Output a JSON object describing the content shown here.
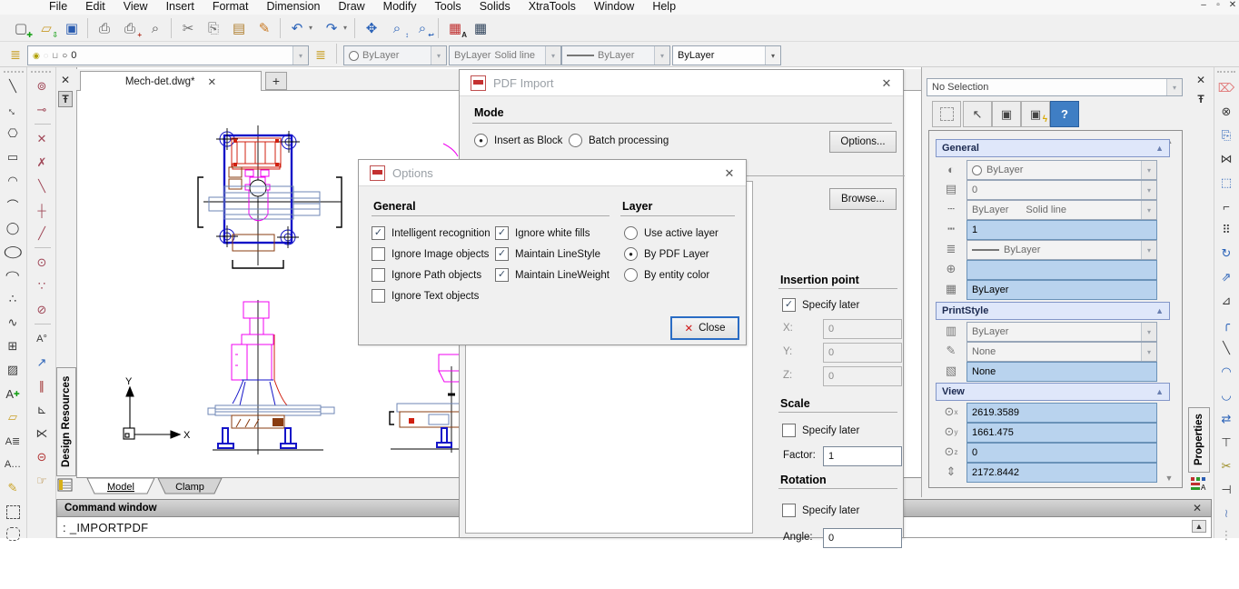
{
  "glyphs": {
    "close": "✕",
    "pin": "Ŧ",
    "caret": "▾",
    "up": "▲",
    "down": "▼",
    "check": "✓",
    "plus": "+",
    "collapse": "▲",
    "dot": "●",
    "minimize": "–",
    "restore": "▫"
  },
  "colors": {
    "field_blue": "#b9d3ee",
    "section_header_bg": "#dfe7fa",
    "help_blue": "#3f7ec4",
    "close_focus_border": "#2a6cc4",
    "accent_blue": "#2a62b8"
  },
  "menu": {
    "items": [
      "File",
      "Edit",
      "View",
      "Insert",
      "Format",
      "Dimension",
      "Draw",
      "Modify",
      "Tools",
      "Solids",
      "XtraTools",
      "Window",
      "Help"
    ]
  },
  "toolbar_main": {
    "icons": [
      {
        "name": "new-file",
        "glyph": "▢",
        "badge": "✚"
      },
      {
        "name": "open-file",
        "glyph": "▱",
        "badge": "⇩"
      },
      {
        "name": "save",
        "glyph": "▣"
      },
      {
        "name": "print",
        "glyph": "⎙"
      },
      {
        "name": "print-copies",
        "glyph": "⎙",
        "badge": "+"
      },
      {
        "name": "print-preview",
        "glyph": "⌕"
      },
      {
        "name": "cut",
        "glyph": "✂"
      },
      {
        "name": "copy",
        "glyph": "⎘"
      },
      {
        "name": "paste",
        "glyph": "▤"
      },
      {
        "name": "draw-pen",
        "glyph": "✎"
      },
      {
        "name": "undo",
        "glyph": "↶"
      },
      {
        "name": "redo",
        "glyph": "↷"
      },
      {
        "name": "pan",
        "glyph": "✥"
      },
      {
        "name": "zoom-realtime",
        "glyph": "⌕",
        "badge": "↕"
      },
      {
        "name": "zoom-previous",
        "glyph": "⌕",
        "badge": "↩"
      },
      {
        "name": "text-style",
        "glyph": "▦",
        "badge": "A"
      },
      {
        "name": "table",
        "glyph": "▦"
      }
    ]
  },
  "toolbar_layer": {
    "layer_manager_glyph": "≣",
    "bulb_glyph": "◉",
    "freeze_glyph": "◌",
    "lock_glyph": "⊔",
    "swatch_glyph": "○",
    "layer_value": "0",
    "layer_props_glyph": "≣",
    "color_value": "ByLayer",
    "linetype_value": "ByLayer",
    "linetype_style": "Solid line",
    "lineweight_value": "ByLayer",
    "plotstyle_value": "ByLayer"
  },
  "doc_tabs": {
    "active": "Mech-det.dwg*",
    "close": "✕",
    "new_tab": "+"
  },
  "left_toolbar_draw": {
    "icons": [
      {
        "name": "line",
        "glyph": "╲"
      },
      {
        "name": "construction-line",
        "glyph": "↔"
      },
      {
        "name": "polygon",
        "glyph": "⎔"
      },
      {
        "name": "rectangle",
        "glyph": "▭"
      },
      {
        "name": "arc-3point",
        "glyph": "◠"
      },
      {
        "name": "arc",
        "glyph": "⌒"
      },
      {
        "name": "circle",
        "glyph": "◯"
      },
      {
        "name": "ellipse",
        "glyph": "◯"
      },
      {
        "name": "ellipse-arc",
        "glyph": "◠"
      },
      {
        "name": "multiple-points",
        "glyph": "∴"
      },
      {
        "name": "spline",
        "glyph": "∿"
      },
      {
        "name": "insert-block",
        "glyph": "⊞"
      },
      {
        "name": "hatch",
        "glyph": "▨"
      },
      {
        "name": "text-new",
        "glyph": "A",
        "badge": "✚"
      },
      {
        "name": "region",
        "glyph": "▱"
      },
      {
        "name": "mtext",
        "glyph": "A≣"
      },
      {
        "name": "single-text",
        "glyph": "A…"
      },
      {
        "name": "sketch",
        "glyph": "✎"
      },
      {
        "name": "select-rect",
        "glyph": ""
      },
      {
        "name": "select-polygon",
        "glyph": ""
      }
    ]
  },
  "left_toolbar_point": {
    "icons": [
      {
        "name": "point-style",
        "glyph": "⊚"
      },
      {
        "name": "point-single",
        "glyph": "⊸"
      },
      {
        "name": "divider-1",
        "glyph": "|"
      },
      {
        "name": "snap-intersection",
        "glyph": "✕"
      },
      {
        "name": "snap-apparent-intersection",
        "glyph": "✗"
      },
      {
        "name": "snap-nearest",
        "glyph": "╲"
      },
      {
        "name": "snap-from",
        "glyph": "┼"
      },
      {
        "name": "snap-mid",
        "glyph": "╱"
      },
      {
        "name": "divider-2",
        "glyph": "|"
      },
      {
        "name": "snap-center",
        "glyph": "⊙"
      },
      {
        "name": "snap-node",
        "glyph": "∵"
      },
      {
        "name": "snap-tangent",
        "glyph": "⊘"
      },
      {
        "name": "divider-3",
        "glyph": "|"
      },
      {
        "name": "text-angle",
        "glyph": "A°"
      },
      {
        "name": "snap-endpoint",
        "glyph": "↗"
      },
      {
        "name": "snap-parallel",
        "glyph": "∥"
      },
      {
        "name": "snap-perpendicular",
        "glyph": "⊾"
      },
      {
        "name": "snap-extension",
        "glyph": "⋉"
      },
      {
        "name": "snap-none",
        "glyph": "⊝"
      },
      {
        "name": "snap-settings",
        "glyph": "☞"
      }
    ]
  },
  "design_resources": {
    "label": "Design Resources"
  },
  "drawing": {
    "ucs_x": "X",
    "ucs_y": "Y"
  },
  "model_tabs": {
    "tabs": [
      "Model",
      "Clamp"
    ]
  },
  "command_window": {
    "title": "Command window",
    "prompt": ": _IMPORTPDF"
  },
  "pdf_import": {
    "title": "PDF Import",
    "mode": {
      "title": "Mode",
      "radio_insert": "Insert as Block",
      "radio_insert_mark": "●",
      "radio_batch": "Batch processing",
      "radio_batch_mark": "",
      "options_button": "Options..."
    },
    "browse_button": "Browse...",
    "insertion": {
      "title": "Insertion point",
      "specify": "Specify later",
      "specify_mark": "✓",
      "x_label": "X:",
      "x": "0",
      "y_label": "Y:",
      "y": "0",
      "z_label": "Z:",
      "z": "0"
    },
    "scale": {
      "title": "Scale",
      "specify": "Specify later",
      "specify_mark": "",
      "factor_label": "Factor:",
      "factor": "1"
    },
    "rotation": {
      "title": "Rotation",
      "specify": "Specify later",
      "specify_mark": "",
      "angle_label": "Angle:",
      "angle": "0"
    }
  },
  "options_dialog": {
    "title": "Options",
    "general_title": "General",
    "general_items": [
      {
        "label": "Intelligent recognition",
        "mark": "✓"
      },
      {
        "label": "Ignore Image objects",
        "mark": ""
      },
      {
        "label": "Ignore Path objects",
        "mark": ""
      },
      {
        "label": "Ignore Text objects",
        "mark": ""
      },
      {
        "label": "Ignore white fills",
        "mark": "✓"
      },
      {
        "label": "Maintain LineStyle",
        "mark": "✓"
      },
      {
        "label": "Maintain LineWeight",
        "mark": "✓"
      }
    ],
    "layer_title": "Layer",
    "layer_items": [
      {
        "label": "Use active layer",
        "mark": ""
      },
      {
        "label": "By PDF Layer",
        "mark": "●"
      },
      {
        "label": "By entity color",
        "mark": ""
      }
    ],
    "close_button": "Close",
    "close_icon": "✕"
  },
  "properties": {
    "selector": "No Selection",
    "buttons": {
      "select_objects": "⬚",
      "cursor": "↖",
      "window_select": "▣",
      "quick_select": "▣",
      "quick_select_badge": "ϟ",
      "help": "?"
    },
    "general": {
      "title": "General",
      "color_icon": "◐",
      "color": "ByLayer",
      "layer_icon": "▤",
      "layer": "0",
      "linetype_icon": "┄",
      "linetype": "ByLayer",
      "linetype_style": "Solid line",
      "ltscale_icon": "┅",
      "ltscale": "1",
      "lineweight_icon": "≣",
      "lineweight": "ByLayer",
      "hyperlink_icon": "⊕",
      "hyperlink": "",
      "transparency_icon": "▦",
      "transparency": "ByLayer"
    },
    "printstyle": {
      "title": "PrintStyle",
      "style_icon": "▥",
      "style": "ByLayer",
      "table_icon": "✎",
      "table": "None",
      "area_icon": "▧",
      "area": "None"
    },
    "view": {
      "title": "View",
      "cx_icon": "⊙",
      "cx_sub": "x",
      "center_x": "2619.3589",
      "cy_icon": "⊙",
      "cy_sub": "y",
      "center_y": "1661.475",
      "cz_icon": "⊙",
      "cz_sub": "z",
      "center_z": "0",
      "h_icon": "⇕",
      "h_sub": "",
      "height": "2172.8442"
    },
    "side_label": "Properties"
  },
  "right_toolbar": {
    "icons": [
      {
        "name": "erase",
        "glyph": "⌦"
      },
      {
        "name": "oops",
        "glyph": "⊗"
      },
      {
        "name": "copy",
        "glyph": "⎘"
      },
      {
        "name": "mirror",
        "glyph": "⋈"
      },
      {
        "name": "copy-object",
        "glyph": "⬚"
      },
      {
        "name": "offset",
        "glyph": "⌐"
      },
      {
        "name": "array",
        "glyph": "⠿"
      },
      {
        "name": "rotate",
        "glyph": "↻"
      },
      {
        "name": "scale",
        "glyph": "⇗"
      },
      {
        "name": "stretch",
        "glyph": "⊿"
      },
      {
        "name": "fillet",
        "glyph": "╭"
      },
      {
        "name": "chamfer",
        "glyph": "╲"
      },
      {
        "name": "blend-curve",
        "glyph": "◠"
      },
      {
        "name": "blend-curve-2",
        "glyph": "◡"
      },
      {
        "name": "join",
        "glyph": "⇄"
      },
      {
        "name": "break",
        "glyph": "⊤"
      },
      {
        "name": "trim",
        "glyph": "✂"
      },
      {
        "name": "extend",
        "glyph": "⊣"
      },
      {
        "name": "edit-spline",
        "glyph": "≀"
      },
      {
        "name": "break-at-point",
        "glyph": "⋮"
      }
    ]
  }
}
